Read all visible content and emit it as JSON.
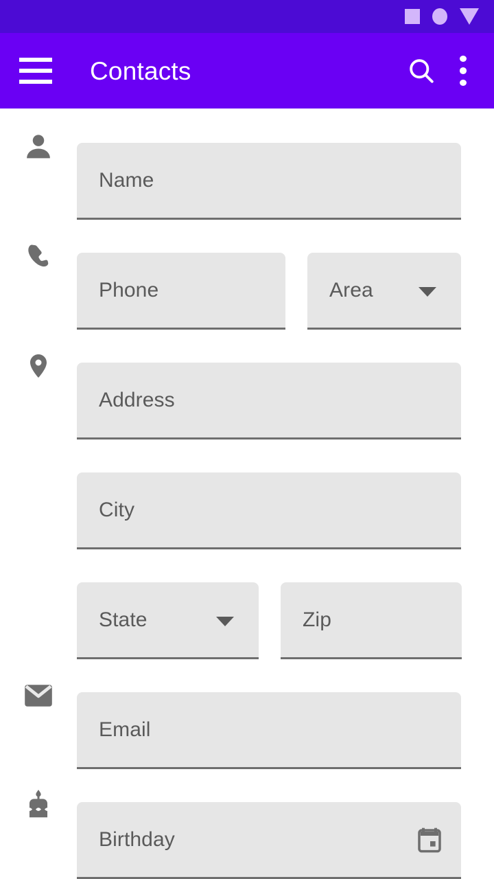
{
  "status_bar": {
    "background": "#4c0bd4",
    "icon_color": "#d3b6fb",
    "icons": [
      {
        "name": "square-indicator-icon",
        "shape": "square"
      },
      {
        "name": "circle-indicator-icon",
        "shape": "circle"
      },
      {
        "name": "triangle-indicator-icon",
        "shape": "triangle"
      }
    ]
  },
  "app_bar": {
    "background": "#6a00f4",
    "foreground": "#ffffff",
    "title": "Contacts",
    "navigation_icon": "hamburger-menu-icon",
    "actions": [
      {
        "name": "search-icon",
        "label": "Search"
      },
      {
        "name": "overflow-menu-icon",
        "label": "More options"
      }
    ]
  },
  "form": {
    "field_background": "#e6e6e6",
    "underline_color": "#6e6e6e",
    "label_color": "#5a5a5a",
    "icon_color": "#6e6e6e",
    "rows": [
      {
        "leading_icon": "person-icon",
        "fields": [
          {
            "name": "name-input",
            "placeholder": "Name",
            "value": "",
            "type": "text"
          }
        ]
      },
      {
        "leading_icon": "phone-icon",
        "fields": [
          {
            "name": "phone-input",
            "placeholder": "Phone",
            "value": "",
            "type": "text"
          },
          {
            "name": "area-dropdown",
            "placeholder": "Area",
            "value": "",
            "type": "dropdown"
          }
        ]
      },
      {
        "leading_icon": "location-pin-icon",
        "fields": [
          {
            "name": "address-input",
            "placeholder": "Address",
            "value": "",
            "type": "text"
          }
        ]
      },
      {
        "leading_icon": "",
        "fields": [
          {
            "name": "city-input",
            "placeholder": "City",
            "value": "",
            "type": "text"
          }
        ]
      },
      {
        "leading_icon": "",
        "fields": [
          {
            "name": "state-dropdown",
            "placeholder": "State",
            "value": "",
            "type": "dropdown"
          },
          {
            "name": "zip-input",
            "placeholder": "Zip",
            "value": "",
            "type": "text"
          }
        ]
      },
      {
        "leading_icon": "envelope-icon",
        "fields": [
          {
            "name": "email-input",
            "placeholder": "Email",
            "value": "",
            "type": "text"
          }
        ]
      },
      {
        "leading_icon": "birthday-cake-icon",
        "fields": [
          {
            "name": "birthday-input",
            "placeholder": "Birthday",
            "value": "",
            "type": "date",
            "trailing_icon": "calendar-icon"
          }
        ]
      }
    ]
  }
}
